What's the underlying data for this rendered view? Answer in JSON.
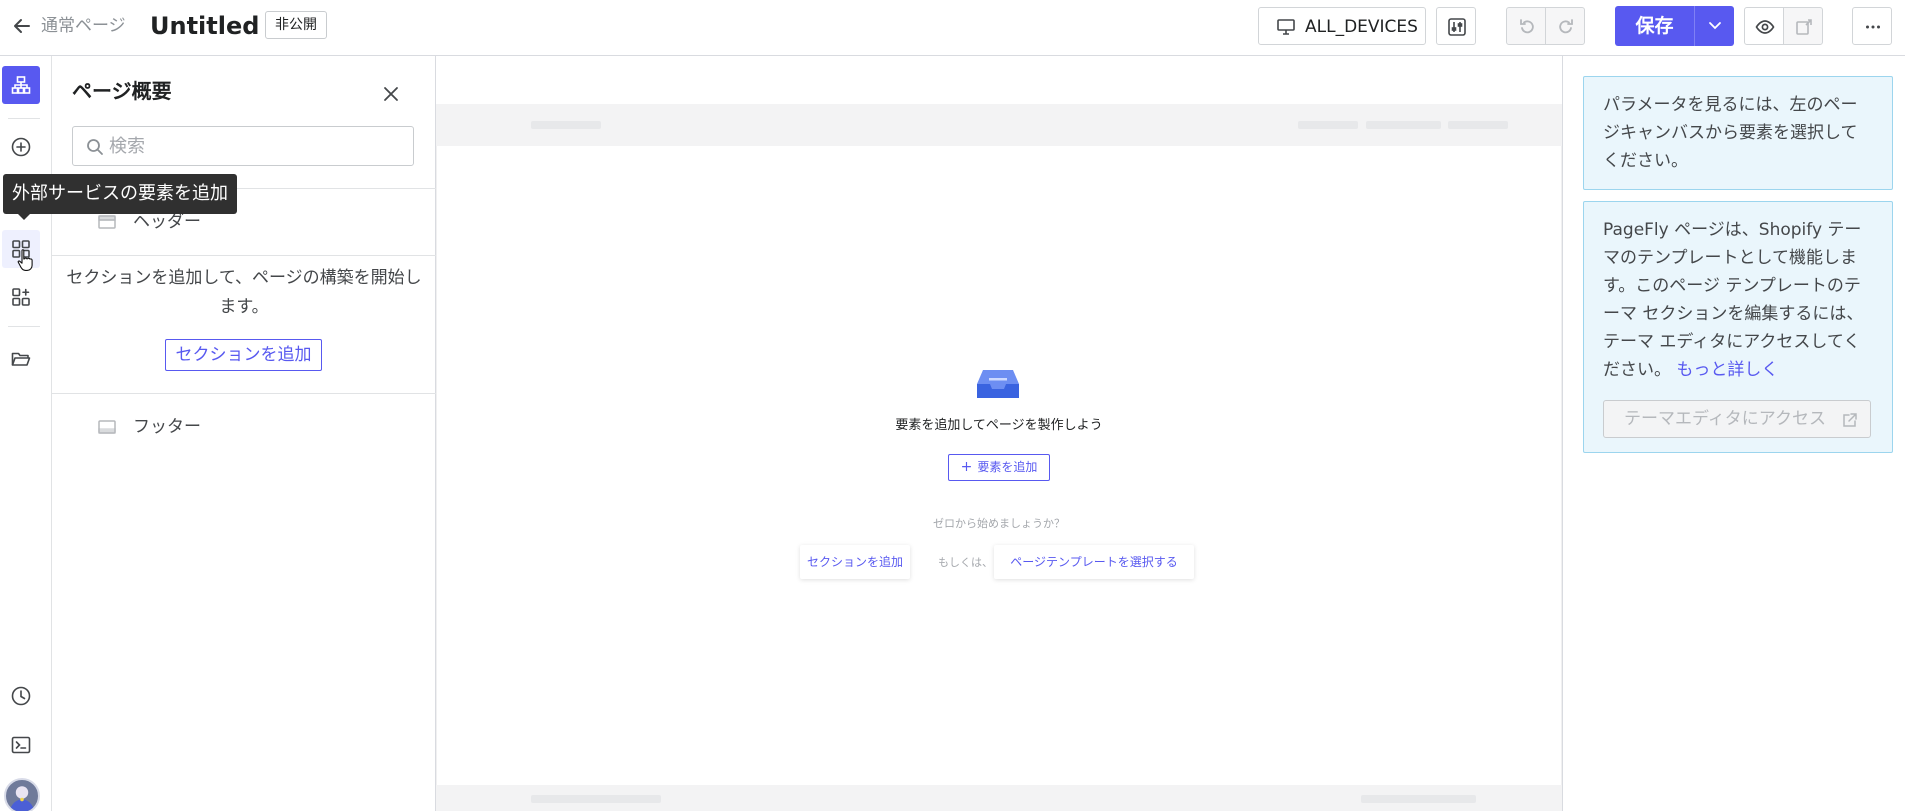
{
  "header": {
    "page_type": "通常ページ",
    "title": "Untitled",
    "status": "非公開",
    "device": "ALL_DEVICES",
    "save_label": "保存"
  },
  "icons": {
    "back": "arrow-left-icon",
    "device": "monitor-icon",
    "tuning": "sliders-icon",
    "undo": "undo-icon",
    "redo": "redo-icon",
    "save_dropdown": "chevron-down-icon",
    "preview": "eye-icon",
    "publish": "publish-icon",
    "more": "ellipsis-icon"
  },
  "rail": {
    "tooltip": "外部サービスの要素を追加",
    "items": [
      "page-outline-icon",
      "add-element-icon",
      "third-party-elements-icon",
      "add-app-icon",
      "folder-icon",
      "history-icon",
      "code-icon"
    ]
  },
  "outline": {
    "title": "ページ概要",
    "search_placeholder": "検索",
    "header_label": "ヘッダー",
    "empty_message": "セクションを追加して、ページの構築を開始します。",
    "add_section_label": "セクションを追加",
    "footer_label": "フッター"
  },
  "canvas": {
    "empty_title": "要素を追加してページを製作しよう",
    "add_element_label": "要素を追加",
    "start_hint": "ゼロから始めましょうか？",
    "add_section_label": "セクションを追加",
    "or_label": "もしくは、",
    "template_label": "ページテンプレートを選択する"
  },
  "inspector": {
    "hint": "パラメータを見るには、左のページキャンバスから要素を選択してください。",
    "theme_info": "PageFly ページは、Shopify テーマのテンプレートとして機能します。このページ テンプレートのテーマ セクションを編集するには、テーマ エディタにアクセスしてください。",
    "learn_more": "もっと詳しく",
    "theme_editor_label": "テーマエディタにアクセス"
  },
  "colors": {
    "accent": "#5859f0",
    "info_bg": "#eaf6fc",
    "info_border": "#9cd5ee",
    "tooltip_bg": "#303030"
  }
}
